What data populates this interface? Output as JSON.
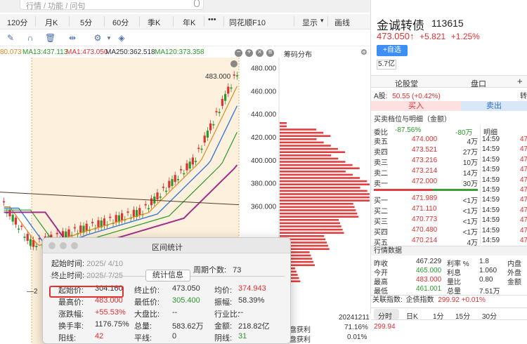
{
  "search": {
    "placeholder": "行情 / 功能 / 问句"
  },
  "periods": [
    "120分",
    "月K",
    "5分",
    "60分",
    "季K",
    "年K",
    "•••",
    "同花顺F10",
    "显示",
    "画线"
  ],
  "ma": {
    "ma_first": "80.073",
    "ma13": "MA13:437.113",
    "ma1": "MA1:473.050",
    "ma250": "MA250:362.518",
    "ma120": "MA120:373.358"
  },
  "chip": {
    "title": "筹码分布"
  },
  "chart_data": {
    "type": "candlestick",
    "y_ticks": [
      "480.000",
      "460.000",
      "440.000",
      "420.000",
      "400.000",
      "380.000",
      "360.000"
    ],
    "ylim": [
      351,
      489
    ],
    "max_label": "483.000",
    "min_label": "2",
    "note": "Price series from 2025/4/10 to 2025/7/25 with sharp rise in final weeks"
  },
  "stock": {
    "name": "金诚转债",
    "code": "113615",
    "price": "473.050↑",
    "change": "+5.821",
    "pct": "+1.25%",
    "add_label": "+自选",
    "vol": "5.7亿"
  },
  "tabs": [
    "论股堂",
    "盘口"
  ],
  "ashare": {
    "label": "A股:",
    "value": "50.55 (+0.42%)",
    "right": "转"
  },
  "bs": {
    "buy": "买入",
    "sell": "卖出"
  },
  "orderbook": {
    "title": "买卖档位与明细（金额）",
    "weibi_label": "委比",
    "weibi_pct": "-87.56%",
    "weibi_amt": "-80万",
    "detail": "明细",
    "asks": [
      {
        "label": "卖五",
        "price": "474.000",
        "amt": "4万"
      },
      {
        "label": "卖四",
        "price": "473.521",
        "amt": "27万"
      },
      {
        "label": "卖三",
        "price": "473.216",
        "amt": "10万"
      },
      {
        "label": "卖二",
        "price": "473.214",
        "amt": "14万"
      },
      {
        "label": "卖一",
        "price": "472.000",
        "amt": "30万"
      }
    ],
    "bids": [
      {
        "label": "买一",
        "price": "471.989",
        "amt": "<1万"
      },
      {
        "label": "买二",
        "price": "471.110",
        "amt": "<1万"
      },
      {
        "label": "买三",
        "price": "470.773",
        "amt": "<1万"
      },
      {
        "label": "买四",
        "price": "470.480",
        "amt": "<1万"
      },
      {
        "label": "买五",
        "price": "470.214",
        "amt": "4万"
      }
    ],
    "ticks": [
      "14:59",
      "14:59",
      "14:59",
      "14:59",
      "14:59",
      "14:59",
      "14:59",
      "14:59",
      "14:59",
      "14:59",
      "14:59",
      "15:00"
    ],
    "tick_val": "47"
  },
  "hq": {
    "title": "行情数据",
    "rows": [
      {
        "l1": "昨收",
        "v1": "467.229",
        "l2": "利率 %",
        "v2": "1.8",
        "l3": "内盘"
      },
      {
        "l1": "今开",
        "v1": "465.000",
        "l2": "利息",
        "v2": "1.060",
        "l3": "外盘"
      },
      {
        "l1": "最高",
        "v1": "483.000",
        "l2": "量比",
        "v2": "0.80",
        "l3": "金额"
      },
      {
        "l1": "最低",
        "v1": "461.001",
        "l2": "总量",
        "v2": "7.51万",
        "l3": ""
      }
    ]
  },
  "guanlian": {
    "label": "关联指数:",
    "name": "企债指数",
    "value": "299.92 +0.01%"
  },
  "bottom_tabs": [
    "分时",
    "日K",
    "1分",
    "15分",
    "30分"
  ],
  "mini_price": "299.94",
  "dialog": {
    "title": "区间统计",
    "start_label": "起始时间:",
    "start_val": "2025/  4/10",
    "end_label": "终止时间:",
    "end_val": "2025/  7/25",
    "period_label": "周期个数:",
    "period_val": "73",
    "stat_btn": "统计信息",
    "stats": [
      {
        "l": "起始价:",
        "v": "304.160",
        "c": ""
      },
      {
        "l": "终止价:",
        "v": "473.050",
        "c": ""
      },
      {
        "l": "均价:",
        "v": "374.943",
        "c": "red"
      },
      {
        "l": "最高价:",
        "v": "483.000",
        "c": "red"
      },
      {
        "l": "最低价:",
        "v": "305.400",
        "c": "green"
      },
      {
        "l": "振幅:",
        "v": "58.39%",
        "c": ""
      },
      {
        "l": "涨跌幅:",
        "v": "+55.53%",
        "c": "red"
      },
      {
        "l": "大盘比:",
        "v": "--",
        "c": ""
      },
      {
        "l": "行业比:",
        "v": "--",
        "c": ""
      },
      {
        "l": "换手率:",
        "v": "1176.75%",
        "c": ""
      },
      {
        "l": "总量:",
        "v": "583.62万",
        "c": ""
      },
      {
        "l": "金额:",
        "v": "218.82亿",
        "c": ""
      },
      {
        "l": "阳线:",
        "v": "42",
        "c": "red"
      },
      {
        "l": "平线:",
        "v": "0",
        "c": ""
      },
      {
        "l": "阴线:",
        "v": "31",
        "c": "green"
      }
    ]
  },
  "profit": {
    "date": "20241211",
    "l1": "盘获利",
    "v1": "71.16%",
    "l2": "盘获利",
    "v2": "0.01%"
  }
}
